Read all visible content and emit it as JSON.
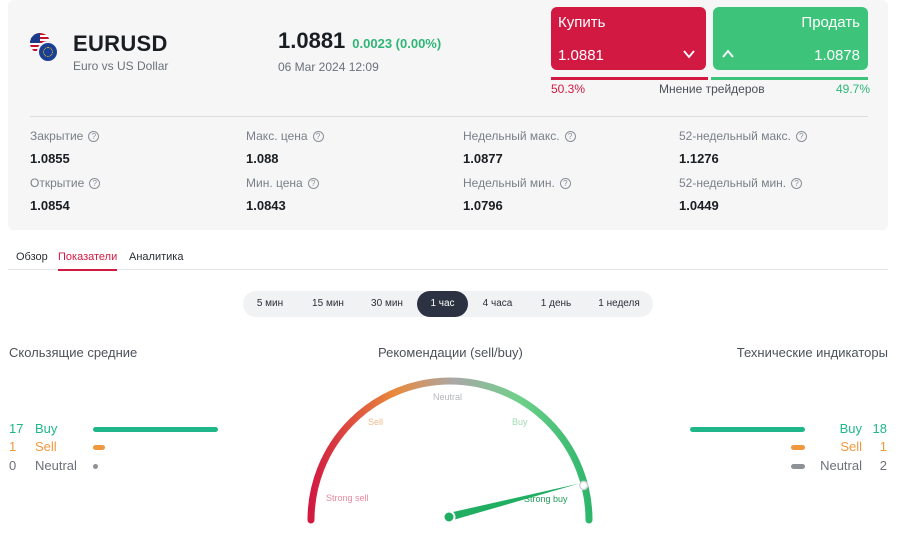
{
  "header": {
    "symbol": "EURUSD",
    "description": "Euro vs US Dollar",
    "price": "1.0881",
    "change": "0.0023 (0.00%)",
    "datetime": "06 Mar 2024 12:09"
  },
  "trade": {
    "buy_label": "Купить",
    "buy_price": "1.0881",
    "sell_label": "Продать",
    "sell_price": "1.0878",
    "buy_percent": "50.3%",
    "sell_percent": "49.7%",
    "sentiment_label": "Мнение трейдеров",
    "buy_share": 50.3,
    "sell_share": 49.7
  },
  "stats": [
    {
      "label": "Закрытие",
      "value": "1.0855"
    },
    {
      "label": "Макс. цена",
      "value": "1.088"
    },
    {
      "label": "Недельный макс.",
      "value": "1.0877"
    },
    {
      "label": "52-недельный макс.",
      "value": "1.1276"
    },
    {
      "label": "Открытие",
      "value": "1.0854"
    },
    {
      "label": "Мин. цена",
      "value": "1.0843"
    },
    {
      "label": "Недельный мин.",
      "value": "1.0796"
    },
    {
      "label": "52-недельный мин.",
      "value": "1.0449"
    }
  ],
  "tabs": [
    "Обзор",
    "Показатели",
    "Аналитика"
  ],
  "active_tab": "Показатели",
  "periods": [
    "5 мин",
    "15 мин",
    "30 мин",
    "1 час",
    "4 часа",
    "1 день",
    "1 неделя"
  ],
  "active_period": "1 час",
  "moving_averages": {
    "title": "Скользящие средние",
    "buy": {
      "count": "17",
      "label": "Buy",
      "value": 17
    },
    "sell": {
      "count": "1",
      "label": "Sell",
      "value": 1
    },
    "neutral": {
      "count": "0",
      "label": "Neutral",
      "value": 0
    }
  },
  "recommendations": {
    "title": "Рекомендации (sell/buy)",
    "labels": {
      "strong_sell": "Strong sell",
      "sell": "Sell",
      "neutral": "Neutral",
      "buy": "Buy",
      "strong_buy": "Strong buy"
    },
    "needle_value": 0.92
  },
  "technical_indicators": {
    "title": "Технические индикаторы",
    "buy": {
      "count": "18",
      "label": "Buy",
      "value": 18
    },
    "sell": {
      "count": "1",
      "label": "Sell",
      "value": 1
    },
    "neutral": {
      "count": "2",
      "label": "Neutral",
      "value": 2
    }
  },
  "colors": {
    "buy_red": "#d21942",
    "sell_green": "#3ec47a",
    "indicator_buy": "#1fb78a",
    "indicator_sell": "#f0983e",
    "indicator_neutral": "#8e9196"
  },
  "icons": {
    "help": "question-circle-icon",
    "buy_chevron": "chevron-down-icon",
    "sell_chevron": "chevron-up-icon",
    "flag": "eur-usd-flag-icon"
  }
}
